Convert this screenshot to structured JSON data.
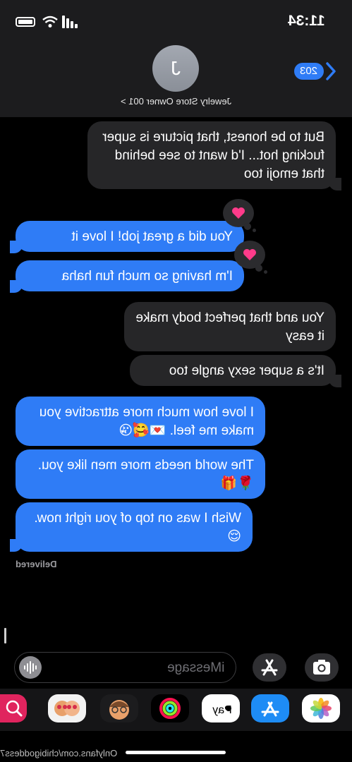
{
  "status_bar": {
    "time": "11:34"
  },
  "header": {
    "back_count": "203",
    "avatar_initial": "J",
    "contact_name": "Jewelry Store Owner 001 >"
  },
  "messages": [
    {
      "side": "received",
      "text": "But to be honest, that picture is super fucking hot... I'd want to see behind that emoji too"
    },
    {
      "side": "sent",
      "text": "You did a great job! I love it",
      "tapback": "heart-icon"
    },
    {
      "side": "sent",
      "text": "I'm having so much fun haha",
      "tapback": "heart-icon"
    },
    {
      "side": "received",
      "text": "You and that perfect body make it easy"
    },
    {
      "side": "received",
      "text": "It's a super sexy angle too"
    },
    {
      "side": "sent",
      "text": "I love how much more attractive you make me feel. 💌🥰😘"
    },
    {
      "side": "sent",
      "text": "The world needs more men like you. 🌹🎁"
    },
    {
      "side": "sent",
      "text": "Wish I was on top of you right now. 😌"
    }
  ],
  "delivered_label": "Delivered",
  "input": {
    "placeholder": "iMessage"
  },
  "icons": {
    "apps": "app-store-icon",
    "camera": "camera-icon",
    "audio": "audio-waveform-icon"
  },
  "drawer_apps": [
    "photos",
    "app-store",
    "apple-pay",
    "activity",
    "memoji",
    "memoji-stickers",
    "search-images"
  ],
  "drawer_labels": {
    "apple_pay": "Pay"
  },
  "watermark": "Onlyfans.com/chibigoddess7",
  "colors": {
    "sent": "#2f7cf6",
    "received": "#262628",
    "background": "#000000",
    "heart": "#ff3b8a"
  }
}
